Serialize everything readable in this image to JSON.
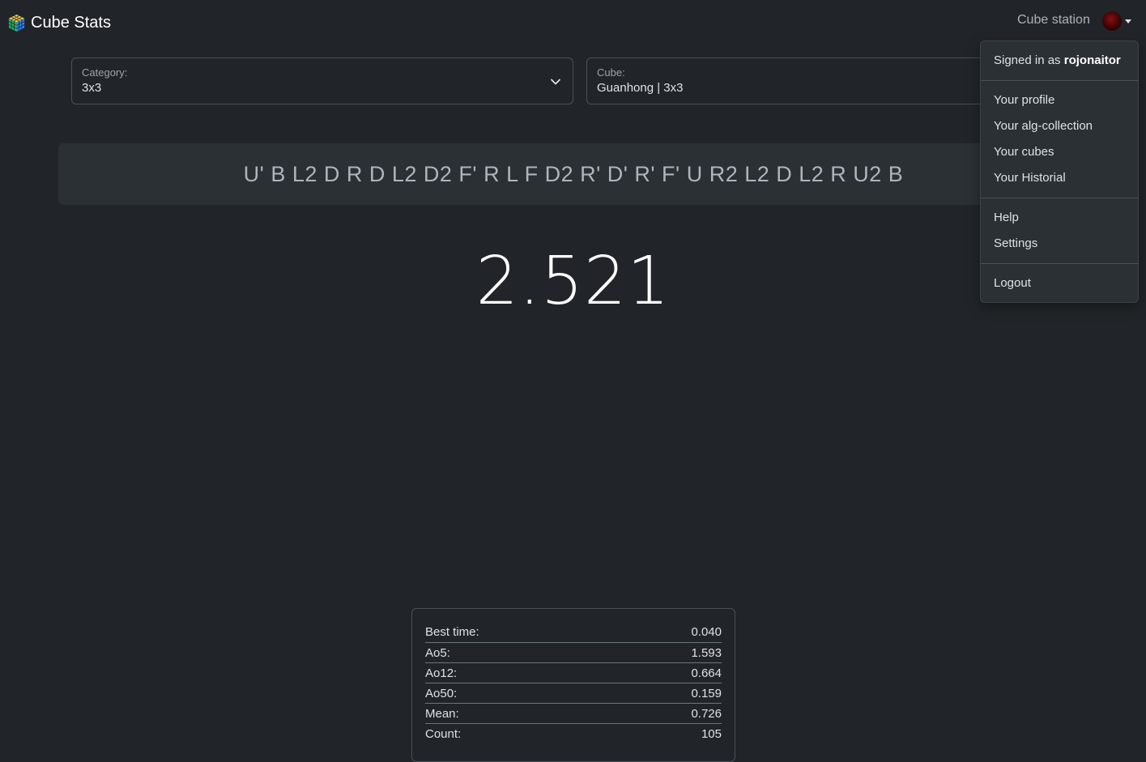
{
  "navbar": {
    "brand": "Cube Stats",
    "nav_link": "Cube station",
    "user_avatar_icon": "user-avatar-icon"
  },
  "selectors": {
    "category": {
      "label": "Category:",
      "value": "3x3"
    },
    "cube": {
      "label": "Cube:",
      "value": "Guanhong | 3x3"
    }
  },
  "scramble": "U' B L2 D R D L2 D2 F' R L F D2 R' D' R' F' U R2 L2 D L2 R U2 B",
  "timer": "2.521",
  "stats": [
    {
      "label": "Best time:",
      "value": "0.040"
    },
    {
      "label": "Ao5:",
      "value": "1.593"
    },
    {
      "label": "Ao12:",
      "value": "0.664"
    },
    {
      "label": "Ao50:",
      "value": "0.159"
    },
    {
      "label": "Mean:",
      "value": "0.726"
    },
    {
      "label": "Count:",
      "value": "105"
    }
  ],
  "user_menu": {
    "signed_in_prefix": "Signed in as",
    "username": "rojonaitor",
    "items": [
      "Your profile",
      "Your alg-collection",
      "Your cubes",
      "Your Historial",
      "Help",
      "Settings",
      "Logout"
    ]
  },
  "colors": {
    "background": "#212529",
    "panel": "#2b3035",
    "border": "#495057",
    "text": "#dee2e6"
  }
}
